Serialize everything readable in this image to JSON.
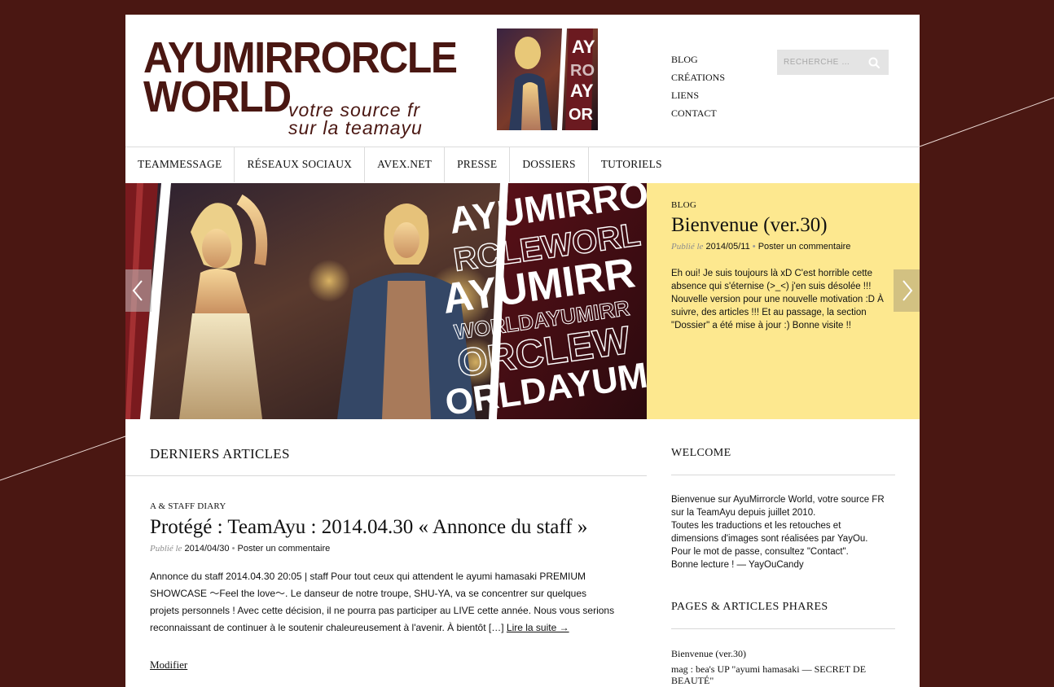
{
  "brand": {
    "logo_line1": "AYUMIRRORCLE",
    "logo_line2": "WORLD",
    "tagline_line1": "votre source fr",
    "tagline_line2": "sur la teamayu",
    "color_primary": "#4a1712",
    "color_highlight": "#fde88f"
  },
  "top_links": [
    {
      "label": "BLOG"
    },
    {
      "label": "CRÉATIONS"
    },
    {
      "label": "LIENS"
    },
    {
      "label": "CONTACT"
    }
  ],
  "search": {
    "placeholder": "RECHERCHE …",
    "icon": "search-icon"
  },
  "nav": [
    {
      "label": "TEAMMESSAGE"
    },
    {
      "label": "RÉSEAUX SOCIAUX"
    },
    {
      "label": "AVEX.NET"
    },
    {
      "label": "PRESSE"
    },
    {
      "label": "DOSSIERS"
    },
    {
      "label": "TUTORIELS"
    }
  ],
  "slider": {
    "banner_words": [
      "AYUMIRROR",
      "RCLEWORL",
      "AYUMIRR",
      "WORLDAYUMIRR",
      "ORCLEW",
      "ORLDAYUMIR"
    ],
    "category": "BLOG",
    "title": "Bienvenue (ver.30)",
    "published_label": "Publié le",
    "date": "2014/05/11",
    "separator": "•",
    "comment_link": "Poster un commentaire",
    "excerpt": "Eh oui! Je suis toujours là xD C'est horrible cette absence qui s'éternise (>_<) j'en suis désolée !!! Nouvelle version pour une nouvelle motivation :D À suivre, des articles !!! Et au passage, la section \"Dossier\" a été mise à jour :) Bonne visite !!",
    "prev_icon": "chevron-left-icon",
    "next_icon": "chevron-right-icon"
  },
  "main": {
    "section_title": "DERNIERS ARTICLES",
    "post": {
      "category": "A & STAFF DIARY",
      "title": "Protégé : TeamAyu : 2014.04.30 « Annonce du staff »",
      "published_label": "Publié le",
      "date": "2014/04/30",
      "separator": "•",
      "comment_link": "Poster un commentaire",
      "excerpt": "Annonce du staff 2014.04.30 20:05 | staff Pour tout ceux qui attendent le ayumi hamasaki PREMIUM SHOWCASE 〜Feel the love〜. Le danseur de notre troupe, SHU-YA, va se concentrer sur quelques projets personnels ! Avec cette décision, il ne pourra pas participer au LIVE cette année. Nous vous serions reconnaissant de continuer à le soutenir chaleureusement à l'avenir. À bientôt […]",
      "read_more": "Lire la suite →",
      "edit_link": "Modifier"
    }
  },
  "sidebar": {
    "welcome_title": "WELCOME",
    "welcome_lines": [
      "Bienvenue sur AyuMirrorcle World, votre source FR",
      "sur la TeamAyu depuis juillet 2010.",
      "Toutes les traductions et les retouches et",
      "dimensions d'images sont réalisées par YayOu.",
      "Pour le mot de passe, consultez \"Contact\".",
      "Bonne lecture ! — YayOuCandy"
    ],
    "pages_title": "PAGES & ARTICLES PHARES",
    "pages": [
      {
        "label": "Bienvenue (ver.30)"
      },
      {
        "label": "mag : bea's UP \"ayumi hamasaki — SECRET DE BEAUTÉ\""
      }
    ]
  }
}
